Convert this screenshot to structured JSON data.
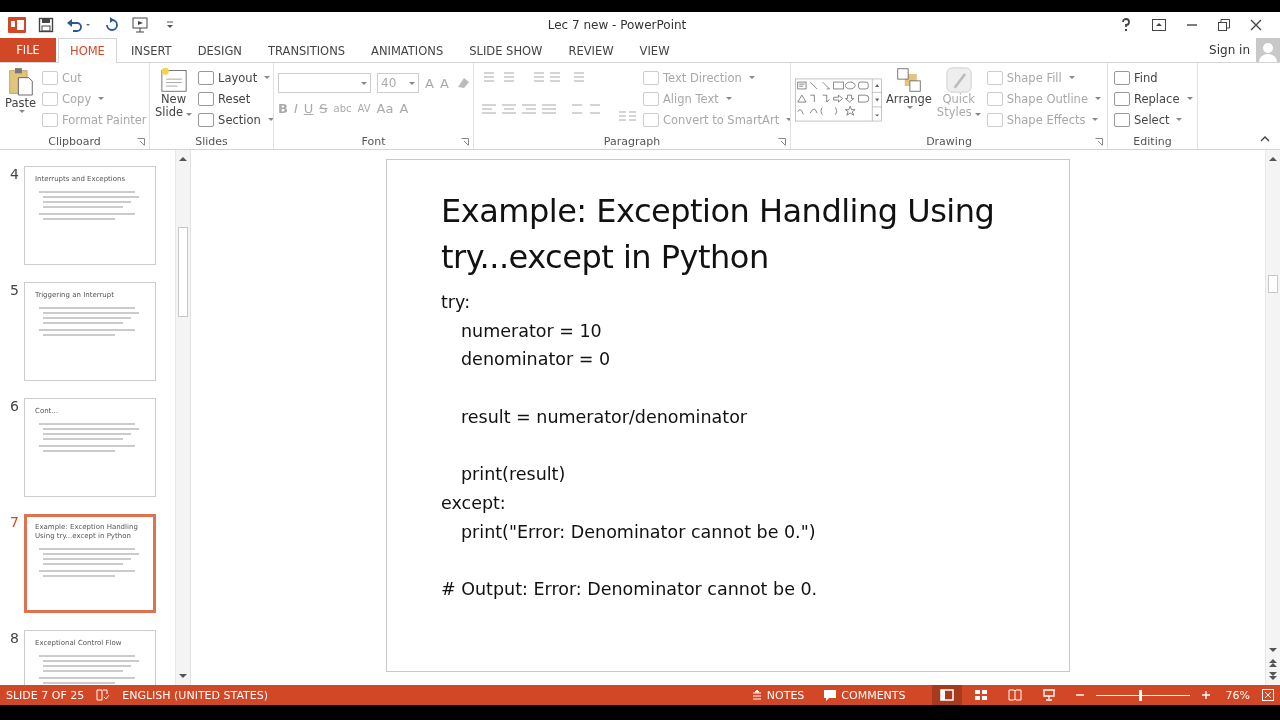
{
  "window": {
    "title": "Lec 7 new - PowerPoint",
    "sign_in": "Sign in"
  },
  "file_tab": "FILE",
  "tabs": [
    {
      "label": "HOME",
      "selected": true
    },
    {
      "label": "INSERT",
      "selected": false
    },
    {
      "label": "DESIGN",
      "selected": false
    },
    {
      "label": "TRANSITIONS",
      "selected": false
    },
    {
      "label": "ANIMATIONS",
      "selected": false
    },
    {
      "label": "SLIDE SHOW",
      "selected": false
    },
    {
      "label": "REVIEW",
      "selected": false
    },
    {
      "label": "VIEW",
      "selected": false
    }
  ],
  "ribbon": {
    "clipboard": {
      "label": "Clipboard",
      "paste": "Paste",
      "commands": [
        {
          "label": "Cut",
          "disabled": true,
          "dropdown": false
        },
        {
          "label": "Copy",
          "disabled": true,
          "dropdown": true
        },
        {
          "label": "Format Painter",
          "disabled": true,
          "dropdown": false
        }
      ]
    },
    "slides": {
      "label": "Slides",
      "new_slide": [
        "New",
        "Slide"
      ],
      "commands": [
        {
          "label": "Layout",
          "disabled": false,
          "dropdown": true
        },
        {
          "label": "Reset",
          "disabled": false,
          "dropdown": false
        },
        {
          "label": "Section",
          "disabled": false,
          "dropdown": true
        }
      ]
    },
    "font": {
      "label": "Font",
      "size": "40",
      "row1": [
        "A",
        "A"
      ],
      "row2": [
        "B",
        "I",
        "U",
        "S",
        "abc",
        "AV",
        "Aa",
        "A"
      ]
    },
    "paragraph": {
      "label": "Paragraph",
      "commands": [
        {
          "label": "Text Direction",
          "disabled": true,
          "dropdown": true
        },
        {
          "label": "Align Text",
          "disabled": true,
          "dropdown": true
        },
        {
          "label": "Convert to SmartArt",
          "disabled": true,
          "dropdown": true
        }
      ]
    },
    "drawing": {
      "label": "Drawing",
      "arrange": "Arrange",
      "quick_styles": [
        "Quick",
        "Styles"
      ],
      "commands": [
        {
          "label": "Shape Fill",
          "disabled": true,
          "dropdown": true
        },
        {
          "label": "Shape Outline",
          "disabled": true,
          "dropdown": true
        },
        {
          "label": "Shape Effects",
          "disabled": true,
          "dropdown": true
        }
      ]
    },
    "editing": {
      "label": "Editing",
      "commands": [
        {
          "label": "Find",
          "disabled": false,
          "dropdown": false
        },
        {
          "label": "Replace",
          "disabled": false,
          "dropdown": true
        },
        {
          "label": "Select",
          "disabled": false,
          "dropdown": true
        }
      ]
    }
  },
  "thumbnails": [
    {
      "number": "4",
      "title": "Interrupts and Exceptions",
      "selected": false
    },
    {
      "number": "5",
      "title": "Triggering an Interrupt",
      "selected": false
    },
    {
      "number": "6",
      "title": "Cont…",
      "selected": false
    },
    {
      "number": "7",
      "title": "Example: Exception Handling Using try...except in Python",
      "selected": true
    },
    {
      "number": "8",
      "title": "Exceptional Control Flow",
      "selected": false
    }
  ],
  "slide": {
    "title": [
      "Example: Exception Handling Using",
      "try...except in Python"
    ],
    "lines": [
      {
        "kind": "plain",
        "text": "try:"
      },
      {
        "kind": "indent",
        "text": "numerator = 10"
      },
      {
        "kind": "indent",
        "text": "denominator = 0"
      },
      {
        "kind": "blank"
      },
      {
        "kind": "indent",
        "text": "result = numerator/denominator"
      },
      {
        "kind": "blank"
      },
      {
        "kind": "indent",
        "text": "print(result)"
      },
      {
        "kind": "plain",
        "text": "except:"
      },
      {
        "kind": "indent",
        "text": "print(\"Error: Denominator cannot be 0.\")"
      },
      {
        "kind": "blank"
      },
      {
        "kind": "plain",
        "text": "# Output: Error: Denominator cannot be 0."
      }
    ]
  },
  "status_bar": {
    "slide": "SLIDE 7 OF 25",
    "language": "ENGLISH (UNITED STATES)",
    "notes": "NOTES",
    "comments": "COMMENTS",
    "views": [
      {
        "kind": "normal",
        "selected": true
      },
      {
        "kind": "sorter",
        "selected": false
      },
      {
        "kind": "reading",
        "selected": false
      },
      {
        "kind": "show",
        "selected": false
      }
    ],
    "zoom": {
      "level": 0.47,
      "reading": "76%"
    }
  }
}
